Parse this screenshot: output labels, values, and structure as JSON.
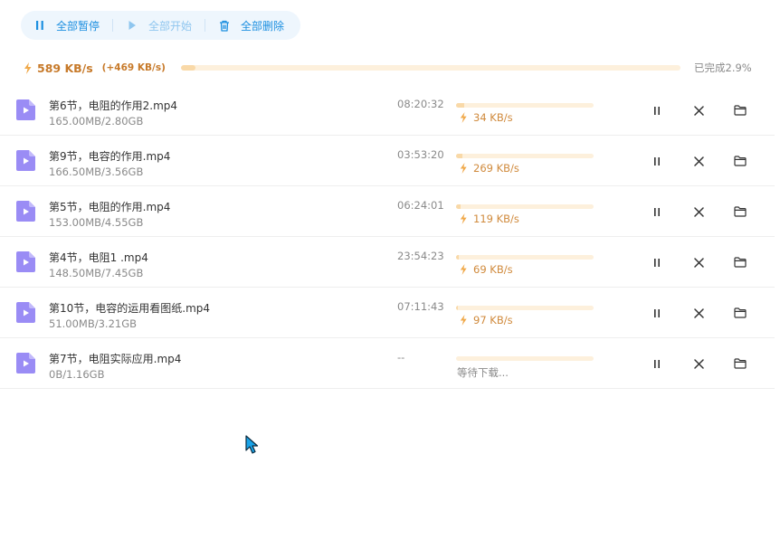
{
  "toolbar": {
    "pause_all": "全部暂停",
    "start_all": "全部开始",
    "delete_all": "全部删除"
  },
  "summary": {
    "speed": "589 KB/s",
    "speed_extra": "(+469 KB/s)",
    "progress_percent": 2.9,
    "progress_text": "已完成2.9%"
  },
  "colors": {
    "accent": "#1c8fe0",
    "speed": "#d08a3c",
    "progress_track": "#fdf0dc",
    "progress_fill": "#f9d9a8",
    "file_icon": "#9a8cf5"
  },
  "icons": {
    "toolbar": [
      "pause-icon",
      "play-icon",
      "trash-icon"
    ],
    "row_actions": [
      "pause-icon",
      "close-icon",
      "folder-icon"
    ],
    "file": "video-file-icon",
    "speed": "bolt-icon"
  },
  "downloads": [
    {
      "name": "第6节，电阻的作用2.mp4",
      "size": "165.00MB/2.80GB",
      "time": "08:20:32",
      "speed": "34 KB/s",
      "status": "",
      "progress": 0.059
    },
    {
      "name": "第9节，电容的作用.mp4",
      "size": "166.50MB/3.56GB",
      "time": "03:53:20",
      "speed": "269 KB/s",
      "status": "",
      "progress": 0.046
    },
    {
      "name": "第5节，电阻的作用.mp4",
      "size": "153.00MB/4.55GB",
      "time": "06:24:01",
      "speed": "119 KB/s",
      "status": "",
      "progress": 0.034
    },
    {
      "name": "第4节，电阻1 .mp4",
      "size": "148.50MB/7.45GB",
      "time": "23:54:23",
      "speed": "69 KB/s",
      "status": "",
      "progress": 0.02
    },
    {
      "name": "第10节，电容的运用看图纸.mp4",
      "size": "51.00MB/3.21GB",
      "time": "07:11:43",
      "speed": "97 KB/s",
      "status": "",
      "progress": 0.016
    },
    {
      "name": "第7节，电阻实际应用.mp4",
      "size": "0B/1.16GB",
      "time": "--",
      "speed": "",
      "status": "等待下载...",
      "progress": 0
    }
  ]
}
